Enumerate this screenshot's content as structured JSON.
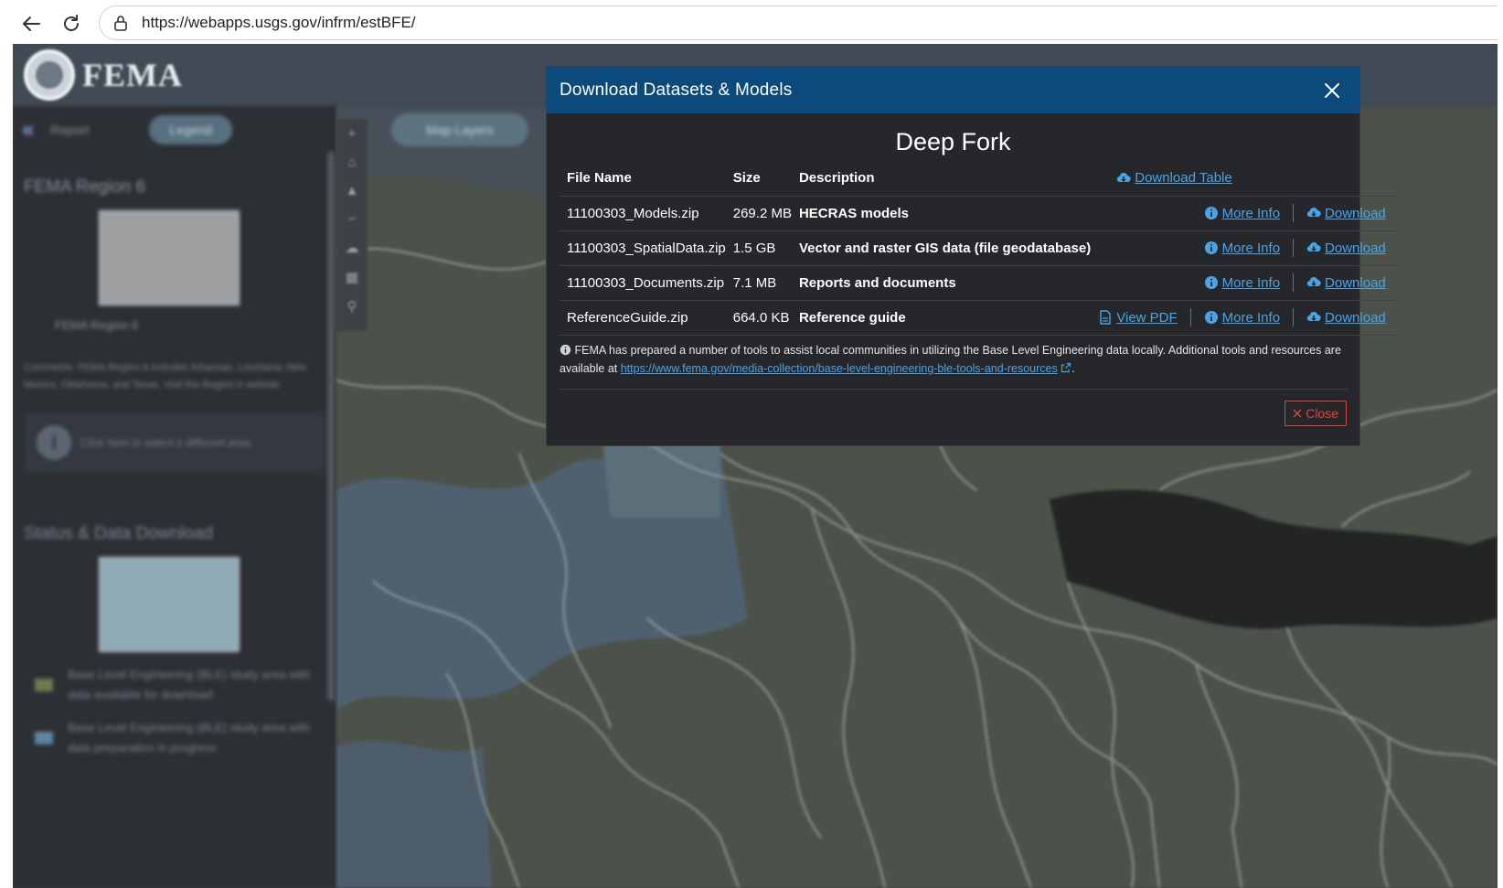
{
  "browser": {
    "url": "https://webapps.usgs.gov/infrm/estBFE/"
  },
  "header": {
    "brand": "FEMA"
  },
  "sidebar": {
    "report_label": "Report",
    "legend_label": "Legend",
    "region_title": "FEMA Region 6",
    "region_label": "FEMA Region 6",
    "comments": "Comments: FEMA Region 6 includes Arkansas, Louisiana, New Mexico, Oklahoma, and Texas. Visit the Region 6 website",
    "info_text": "Click here to select a different area.",
    "status_title": "Status & Data Download",
    "legend_items": [
      {
        "text": "Base Level Engineering (BLE) study area with data available for download",
        "color": "#6f7a4e"
      },
      {
        "text": "Base Level Engineering (BLE) study area with data preparation in progress",
        "color": "#5f86a3"
      }
    ]
  },
  "map": {
    "layers_label": "Map Layers"
  },
  "modal": {
    "title": "Download Datasets & Models",
    "area_name": "Deep Fork",
    "columns": {
      "file_name": "File Name",
      "size": "Size",
      "description": "Description",
      "download_table": "Download Table"
    },
    "rows": [
      {
        "file": "11100303_Models.zip",
        "size": "269.2 MB",
        "desc": "HECRAS models",
        "more_info": "More Info",
        "download": "Download"
      },
      {
        "file": "11100303_SpatialData.zip",
        "size": "1.5 GB",
        "desc": "Vector and raster GIS data (file geodatabase)",
        "more_info": "More Info",
        "download": "Download"
      },
      {
        "file": "11100303_Documents.zip",
        "size": "7.1 MB",
        "desc": "Reports and documents",
        "more_info": "More Info",
        "download": "Download"
      },
      {
        "file": "ReferenceGuide.zip",
        "size": "664.0 KB",
        "desc": "Reference guide",
        "view_pdf": "View PDF",
        "more_info": "More Info",
        "download": "Download"
      }
    ],
    "note_text": "FEMA has prepared a number of tools to assist local communities in utilizing the Base Level Engineering data locally. Additional tools and resources are available at",
    "note_link": "https://www.fema.gov/media-collection/base-level-engineering-ble-tools-and-resources",
    "close_label": "Close"
  },
  "colors": {
    "modal_header": "#0b4a7a",
    "link": "#4aa3e6",
    "close": "#e0443e"
  }
}
